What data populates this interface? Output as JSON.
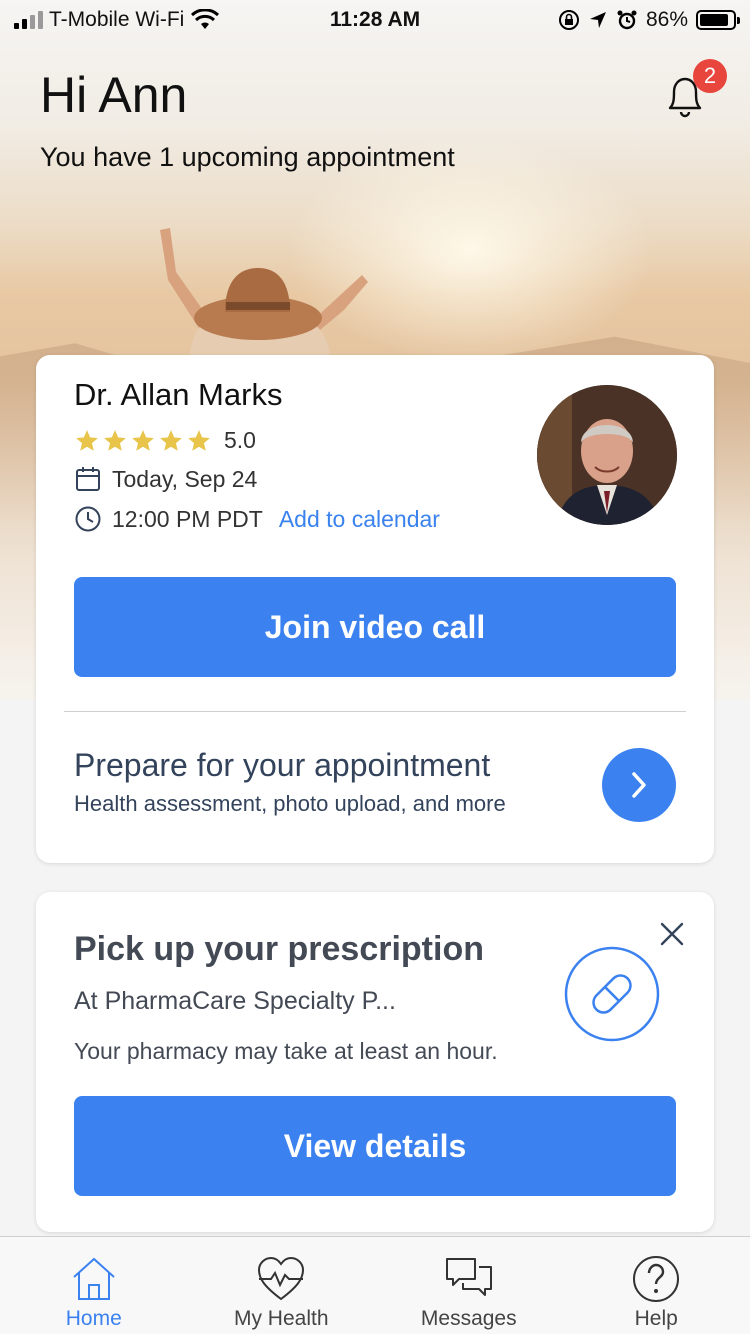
{
  "status": {
    "carrier": "T-Mobile Wi-Fi",
    "time": "11:28 AM",
    "battery": "86%",
    "battery_level": 0.86
  },
  "header": {
    "greeting": "Hi Ann",
    "subtitle": "You have 1 upcoming appointment",
    "notification_count": "2"
  },
  "appointment": {
    "doctor_name": "Dr. Allan Marks",
    "rating": "5.0",
    "stars": 5,
    "date": "Today, Sep 24",
    "time": "12:00 PM PDT",
    "add_to_calendar": "Add to calendar",
    "join_button": "Join video call",
    "prepare_title": "Prepare for your appointment",
    "prepare_subtitle": "Health assessment, photo upload, and more"
  },
  "prescription": {
    "title": "Pick up your prescription",
    "pharmacy": "At PharmaCare Specialty P...",
    "note": "Your pharmacy may take at least an hour.",
    "button": "View details"
  },
  "tabs": [
    {
      "label": "Home",
      "icon": "home-icon",
      "active": true
    },
    {
      "label": "My Health",
      "icon": "heart-pulse-icon",
      "active": false
    },
    {
      "label": "Messages",
      "icon": "chat-icon",
      "active": false
    },
    {
      "label": "Help",
      "icon": "help-icon",
      "active": false
    }
  ],
  "colors": {
    "accent": "#3b82f0",
    "badge": "#e8453c",
    "star": "#e8c44a"
  }
}
